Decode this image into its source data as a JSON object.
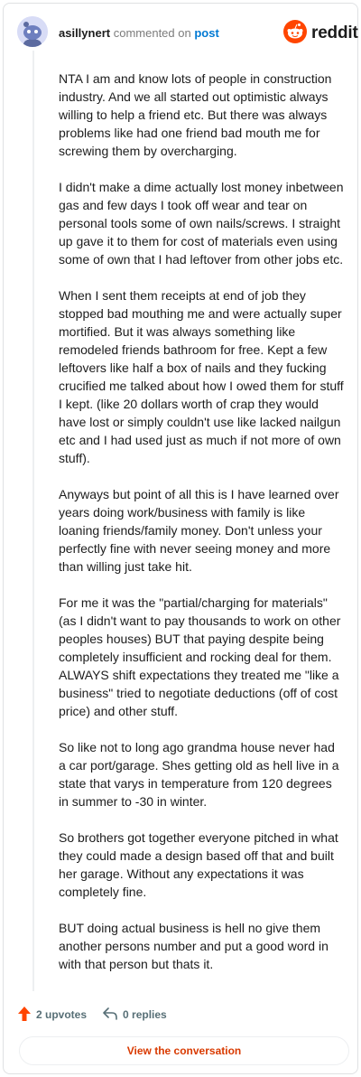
{
  "header": {
    "username": "asillynert",
    "verb": "commented on",
    "post_link": "post",
    "logo_text": "reddit",
    "avatar_icon": "snoo-avatar-icon",
    "logo_icon": "reddit-alien-icon"
  },
  "comment": {
    "paragraphs": [
      "NTA I am and know lots of people in construction industry. And we all started out optimistic always willing to help a friend etc. But there was always problems like had one friend bad mouth me for screwing them by overcharging.",
      "I didn't make a dime actually lost money inbetween gas and few days I took off wear and tear on personal tools some of own nails/screws. I straight up gave it to them for cost of materials even using some of own that I had leftover from other jobs etc.",
      "When I sent them receipts at end of job they stopped bad mouthing me and were actually super mortified. But it was always something like remodeled friends bathroom for free. Kept a few leftovers like half a box of nails and they fucking crucified me talked about how I owed them for stuff I kept. (like 20 dollars worth of crap they would have lost or simply couldn't use like lacked nailgun etc and I had used just as much if not more of own stuff).",
      "Anyways but point of all this is I have learned over years doing work/business with family is like loaning friends/family money. Don't unless your perfectly fine with never seeing money and more than willing just take hit.",
      "For me it was the \"partial/charging for materials\" (as I didn't want to pay thousands to work on other peoples houses) BUT that paying despite being completely insufficient and rocking deal for them. ALWAYS shift expectations they treated me \"like a business\" tried to negotiate deductions (off of cost price) and other stuff.",
      "So like not to long ago grandma house never had a car port/garage. Shes getting old as hell live in a state that varys in temperature from 120 degrees in summer to -30 in winter.",
      "So brothers got together everyone pitched in what they could made a design based off that and built her garage. Without any expectations it was completely fine.",
      "BUT doing actual business is hell no give them another persons number and put a good word in with that person but thats it."
    ]
  },
  "footer": {
    "upvotes": "2 upvotes",
    "replies": "0 replies",
    "upvote_icon": "upvote-arrow-icon",
    "reply_icon": "reply-arrow-icon",
    "view_conversation": "View the conversation",
    "accent_color": "#ff4500"
  }
}
